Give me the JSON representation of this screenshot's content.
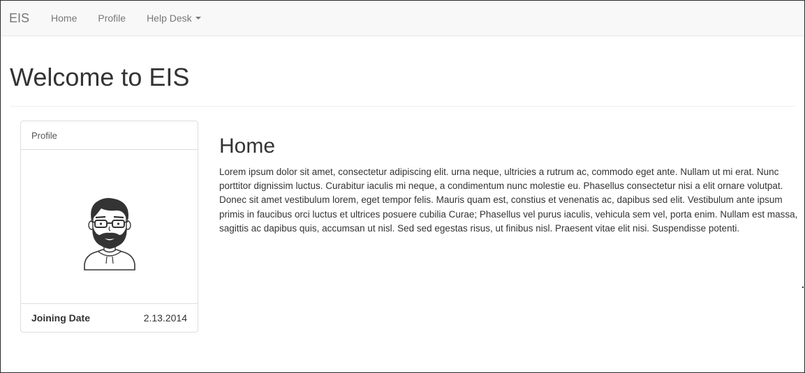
{
  "navbar": {
    "brand": "EIS",
    "items": [
      {
        "label": "Home"
      },
      {
        "label": "Profile"
      },
      {
        "label": "Help Desk",
        "has_caret": true
      }
    ]
  },
  "page": {
    "title": "Welcome to EIS"
  },
  "profile_panel": {
    "heading": "Profile",
    "avatar": "bearded-man-with-glasses-icon",
    "joining_date_label": "Joining Date",
    "joining_date_value": "2.13.2014"
  },
  "home": {
    "title": "Home",
    "body": "Lorem ipsum dolor sit amet, consectetur adipiscing elit. urna neque, ultricies a rutrum ac, commodo eget ante. Nullam ut mi erat. Nunc porttitor dignissim luctus. Curabitur iaculis mi neque, a condimentum nunc molestie eu. Phasellus consectetur nisi a elit ornare volutpat. Donec sit amet vestibulum lorem, eget tempor felis. Mauris quam est, constius et venenatis ac, dapibus sed elit. Vestibulum ante ipsum primis in faucibus orci luctus et ultrices posuere cubilia Curae; Phasellus vel purus iaculis, vehicula sem vel, porta enim. Nullam est massa, sagittis ac dapibus quis, accumsan ut nisl. Sed sed egestas risus, ut finibus nisl. Praesent vitae elit nisi. Suspendisse potenti."
  }
}
